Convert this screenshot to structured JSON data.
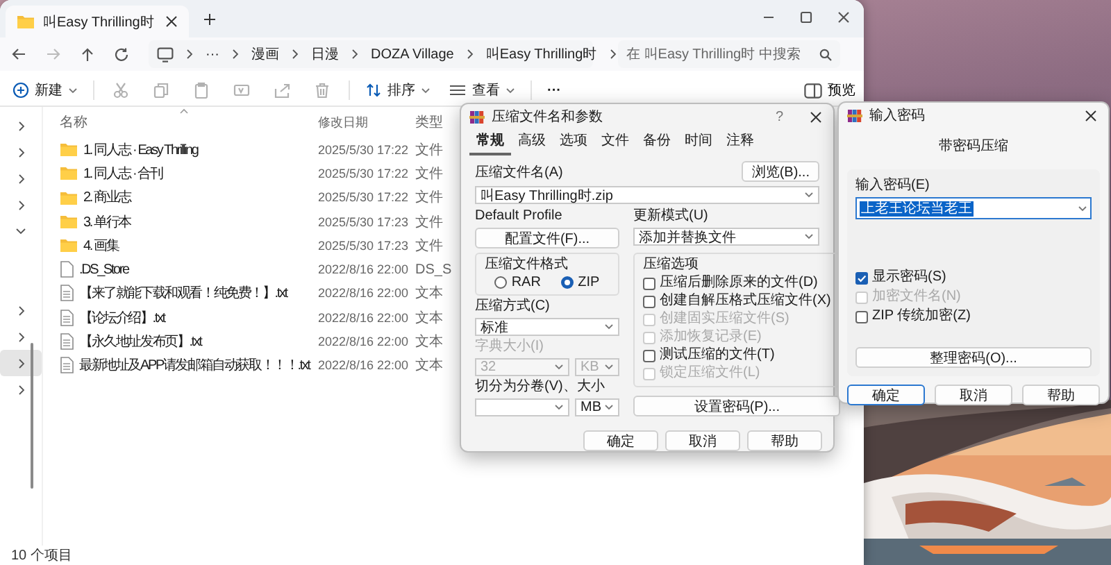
{
  "explorer": {
    "tab": {
      "title": "叫Easy Thrilling时"
    },
    "overflow": "···",
    "breadcrumbs": [
      "漫画",
      "日漫",
      "DOZA Village",
      "叫Easy Thrilling时"
    ],
    "search": {
      "placeholder": "在 叫Easy Thrilling时 中搜索"
    },
    "commands": [
      {
        "kind": "new",
        "label": "新建",
        "disabled": false
      },
      {
        "kind": "cut",
        "disabled": true
      },
      {
        "kind": "copy",
        "disabled": true
      },
      {
        "kind": "paste",
        "disabled": true
      },
      {
        "kind": "rename",
        "disabled": true
      },
      {
        "kind": "share",
        "disabled": true
      },
      {
        "kind": "delete",
        "disabled": true
      },
      {
        "kind": "sort",
        "label": "排序",
        "disabled": false
      },
      {
        "kind": "view",
        "label": "查看",
        "disabled": false
      },
      {
        "kind": "more",
        "label": "···",
        "disabled": false
      }
    ],
    "preview": {
      "label": "预览"
    },
    "nav_groups": [
      {
        "items": [
          {
            "expanded": false,
            "selected": false
          },
          {
            "expanded": false,
            "selected": false
          },
          {
            "expanded": false,
            "selected": false
          },
          {
            "expanded": false,
            "selected": false
          },
          {
            "expanded": true,
            "selected": false
          }
        ]
      },
      {
        "items": [
          {
            "expanded": false,
            "selected": false
          },
          {
            "expanded": false,
            "selected": false
          },
          {
            "expanded": false,
            "selected": true
          },
          {
            "expanded": false,
            "selected": false
          }
        ]
      }
    ],
    "columns": [
      "名称",
      "修改日期",
      "类型"
    ],
    "files": [
      {
        "kind": "folder",
        "name": "1. 同人志 · Easy Thrilling",
        "date": "2025/5/30 17:22",
        "type": "文件"
      },
      {
        "kind": "folder",
        "name": "1. 同人志 · 合刊",
        "date": "2025/5/30 17:22",
        "type": "文件"
      },
      {
        "kind": "folder",
        "name": "2. 商业志",
        "date": "2025/5/30 17:22",
        "type": "文件"
      },
      {
        "kind": "folder",
        "name": "3. 单行本",
        "date": "2025/5/30 17:23",
        "type": "文件"
      },
      {
        "kind": "folder",
        "name": "4. 画集",
        "date": "2025/5/30 17:23",
        "type": "文件"
      },
      {
        "kind": "file",
        "name": ".DS_Store",
        "date": "2022/8/16 22:00",
        "type": "DS_S"
      },
      {
        "kind": "text",
        "name": "【来了就能下载和观看！纯免费！】.txt",
        "date": "2022/8/16 22:00",
        "type": "文本"
      },
      {
        "kind": "text",
        "name": "【论坛介绍】.txt",
        "date": "2022/8/16 22:00",
        "type": "文本"
      },
      {
        "kind": "text",
        "name": "【永久地址发布页】.txt",
        "date": "2022/8/16 22:00",
        "type": "文本"
      },
      {
        "kind": "text",
        "name": "最新地址及APP请发邮箱自动获取！！！.txt",
        "date": "2022/8/16 22:00",
        "type": "文本"
      }
    ],
    "status": "10 个项目"
  },
  "compress_dialog": {
    "title": "压缩文件名和参数",
    "help": "?",
    "tabs": [
      {
        "label": "常规",
        "selected": true
      },
      {
        "label": "高级",
        "selected": false
      },
      {
        "label": "选项",
        "selected": false
      },
      {
        "label": "文件",
        "selected": false
      },
      {
        "label": "备份",
        "selected": false
      },
      {
        "label": "时间",
        "selected": false
      },
      {
        "label": "注释",
        "selected": false
      }
    ],
    "archive_name": {
      "label": "压缩文件名(A)",
      "value": "叫Easy Thrilling时.zip",
      "browse": "浏览(B)..."
    },
    "profile": {
      "label": "Default Profile",
      "button": "配置文件(F)..."
    },
    "update_mode": {
      "label": "更新模式(U)",
      "value": "添加并替换文件"
    },
    "format": {
      "label": "压缩文件格式",
      "options": [
        {
          "label": "RAR",
          "selected": false
        },
        {
          "label": "ZIP",
          "selected": true
        }
      ]
    },
    "method": {
      "label": "压缩方式(C)",
      "value": "标准",
      "disabled": false
    },
    "dictionary": {
      "label": "字典大小(I)",
      "value": "32",
      "unit": "KB",
      "disabled": true
    },
    "split": {
      "label": "切分为分卷(V)、大小",
      "unit": "MB",
      "disabled": false
    },
    "options": {
      "label": "压缩选项",
      "items": [
        {
          "label": "压缩后删除原来的文件(D)",
          "checked": false,
          "disabled": false
        },
        {
          "label": "创建自解压格式压缩文件(X)",
          "checked": false,
          "disabled": false
        },
        {
          "label": "创建固实压缩文件(S)",
          "checked": false,
          "disabled": true
        },
        {
          "label": "添加恢复记录(E)",
          "checked": false,
          "disabled": true
        },
        {
          "label": "测试压缩的文件(T)",
          "checked": false,
          "disabled": false
        },
        {
          "label": "锁定压缩文件(L)",
          "checked": false,
          "disabled": true
        }
      ]
    },
    "set_password": "设置密码(P)...",
    "buttons": [
      {
        "label": "确定",
        "focused": false
      },
      {
        "label": "取消",
        "focused": false
      },
      {
        "label": "帮助",
        "focused": false
      }
    ]
  },
  "password_dialog": {
    "title": "输入密码",
    "subtitle": "带密码压缩",
    "password": {
      "label": "输入密码(E)",
      "value": "上老王论坛当老王",
      "selected": true
    },
    "options": [
      {
        "label": "显示密码(S)",
        "checked": true,
        "disabled": false
      },
      {
        "label": "加密文件名(N)",
        "checked": false,
        "disabled": true
      },
      {
        "label": "ZIP 传统加密(Z)",
        "checked": false,
        "disabled": false
      }
    ],
    "organize": "整理密码(O)...",
    "buttons": [
      {
        "label": "确定",
        "focused": true
      },
      {
        "label": "取消",
        "focused": false
      },
      {
        "label": "帮助",
        "focused": false
      }
    ]
  }
}
